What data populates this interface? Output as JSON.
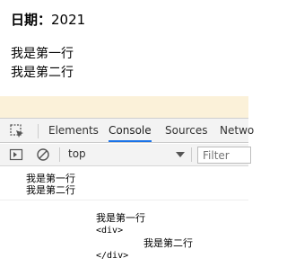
{
  "page": {
    "date_label": "日期：",
    "date_value": "2021",
    "line1": "我是第一行",
    "line2": "我是第二行"
  },
  "devtools": {
    "tabs": [
      {
        "label": "Elements",
        "active": false
      },
      {
        "label": "Console",
        "active": true
      },
      {
        "label": "Sources",
        "active": false
      },
      {
        "label": "Netwo",
        "active": false
      }
    ],
    "context": "top",
    "filter_placeholder": "Filter"
  },
  "console": {
    "log1_line1": "我是第一行",
    "log1_line2": "我是第二行",
    "log2_line1": "我是第一行",
    "log2_line2": "<div>",
    "log2_line3": "我是第二行",
    "log2_line4": "</div>"
  },
  "colors": {
    "active_tab_underline": "#1a73e8",
    "highlight_band": "#fbf1d9",
    "panel_bg": "#f3f3f3"
  }
}
